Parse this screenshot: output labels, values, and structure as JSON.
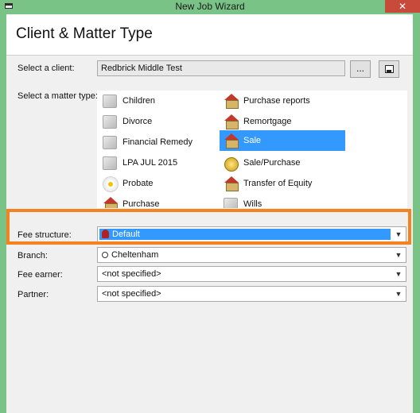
{
  "window": {
    "title": "New Job Wizard",
    "close_glyph": "✕"
  },
  "header": {
    "title": "Client & Matter Type"
  },
  "client": {
    "label": "Select a client:",
    "value": "Redbrick Middle Test",
    "browse_label": "...",
    "save_icon": "save-icon"
  },
  "matter": {
    "label": "Select a matter type:",
    "items": [
      {
        "label": "Children",
        "icon": "document-icon"
      },
      {
        "label": "Purchase reports",
        "icon": "house-coins-icon"
      },
      {
        "label": "Divorce",
        "icon": "document-icon"
      },
      {
        "label": "Remortgage",
        "icon": "house-icon"
      },
      {
        "label": "Financial Remedy",
        "icon": "document-icon"
      },
      {
        "label": "Sale",
        "icon": "house-coins-icon",
        "selected": true
      },
      {
        "label": "LPA JUL 2015",
        "icon": "document-icon"
      },
      {
        "label": "Sale/Purchase",
        "icon": "coins-icon"
      },
      {
        "label": "Probate",
        "icon": "flower-icon"
      },
      {
        "label": "Transfer of Equity",
        "icon": "house-icon"
      },
      {
        "label": "Purchase",
        "icon": "house-coins-icon"
      },
      {
        "label": "Wills",
        "icon": "document-icon"
      }
    ]
  },
  "fee_structure": {
    "label": "Fee structure:",
    "value": "Default"
  },
  "branch": {
    "label": "Branch:",
    "value": "Cheltenham"
  },
  "fee_earner": {
    "label": "Fee earner:",
    "value": "<not specified>"
  },
  "partner": {
    "label": "Partner:",
    "value": "<not specified>"
  },
  "colors": {
    "selection": "#3399ff",
    "highlight": "#f58220",
    "titlebar": "#7ac386"
  }
}
